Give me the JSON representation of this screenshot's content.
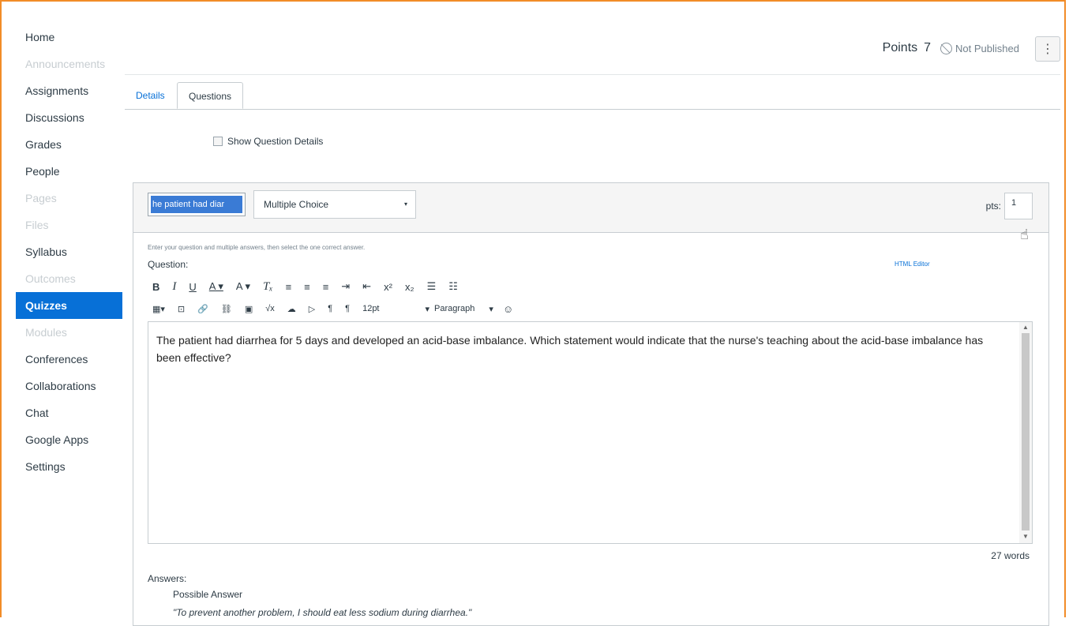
{
  "sidebar": {
    "items": [
      {
        "label": "Home",
        "state": "normal"
      },
      {
        "label": "Announcements",
        "state": "disabled"
      },
      {
        "label": "Assignments",
        "state": "normal"
      },
      {
        "label": "Discussions",
        "state": "normal"
      },
      {
        "label": "Grades",
        "state": "normal"
      },
      {
        "label": "People",
        "state": "normal"
      },
      {
        "label": "Pages",
        "state": "disabled"
      },
      {
        "label": "Files",
        "state": "disabled"
      },
      {
        "label": "Syllabus",
        "state": "normal"
      },
      {
        "label": "Outcomes",
        "state": "disabled"
      },
      {
        "label": "Quizzes",
        "state": "active"
      },
      {
        "label": "Modules",
        "state": "disabled"
      },
      {
        "label": "Conferences",
        "state": "normal"
      },
      {
        "label": "Collaborations",
        "state": "normal"
      },
      {
        "label": "Chat",
        "state": "normal"
      },
      {
        "label": "Google Apps",
        "state": "normal"
      },
      {
        "label": "Settings",
        "state": "normal"
      }
    ]
  },
  "header": {
    "points_label": "Points",
    "points_value": "7",
    "publish_status": "Not Published",
    "kebab_icon": "⋮"
  },
  "tabs": [
    {
      "label": "Details"
    },
    {
      "label": "Questions"
    }
  ],
  "show_details_label": "Show Question Details",
  "question": {
    "name_value": "he patient had diar",
    "type_value": "Multiple Choice",
    "type_caret": "▾",
    "pts_label": "pts:",
    "pts_value": "1",
    "instructions": "Enter your question and multiple answers, then select the one correct answer.",
    "question_label": "Question:",
    "html_editor_label": "HTML Editor",
    "toolbar_row1": [
      "B",
      "I",
      "U",
      "A ▾",
      "A ▾",
      "Tₓ",
      "≡",
      "≡",
      "≡",
      "⇥",
      "⇤",
      "x²",
      "x₂",
      "☰",
      "☷"
    ],
    "toolbar_row2": [
      "▦▾",
      "⊡",
      "🔗",
      "⛓",
      "▣",
      "√x",
      "☁",
      "▷",
      "¶",
      "¶",
      "12pt",
      "▾",
      "Paragraph",
      "▾",
      "☺"
    ],
    "body_text": "The patient had diarrhea for 5 days and developed an acid-base imbalance. Which statement would indicate that the nurse's teaching about the acid-base imbalance has been effective?",
    "word_count": "27 words",
    "answers_label": "Answers:",
    "possible_answer_label": "Possible Answer",
    "answer_text": "\"To prevent another problem, I should eat less sodium during diarrhea.\""
  },
  "colors": {
    "accent": "#0770d7",
    "frame": "#f28c28",
    "selection": "#3a7bd5"
  }
}
